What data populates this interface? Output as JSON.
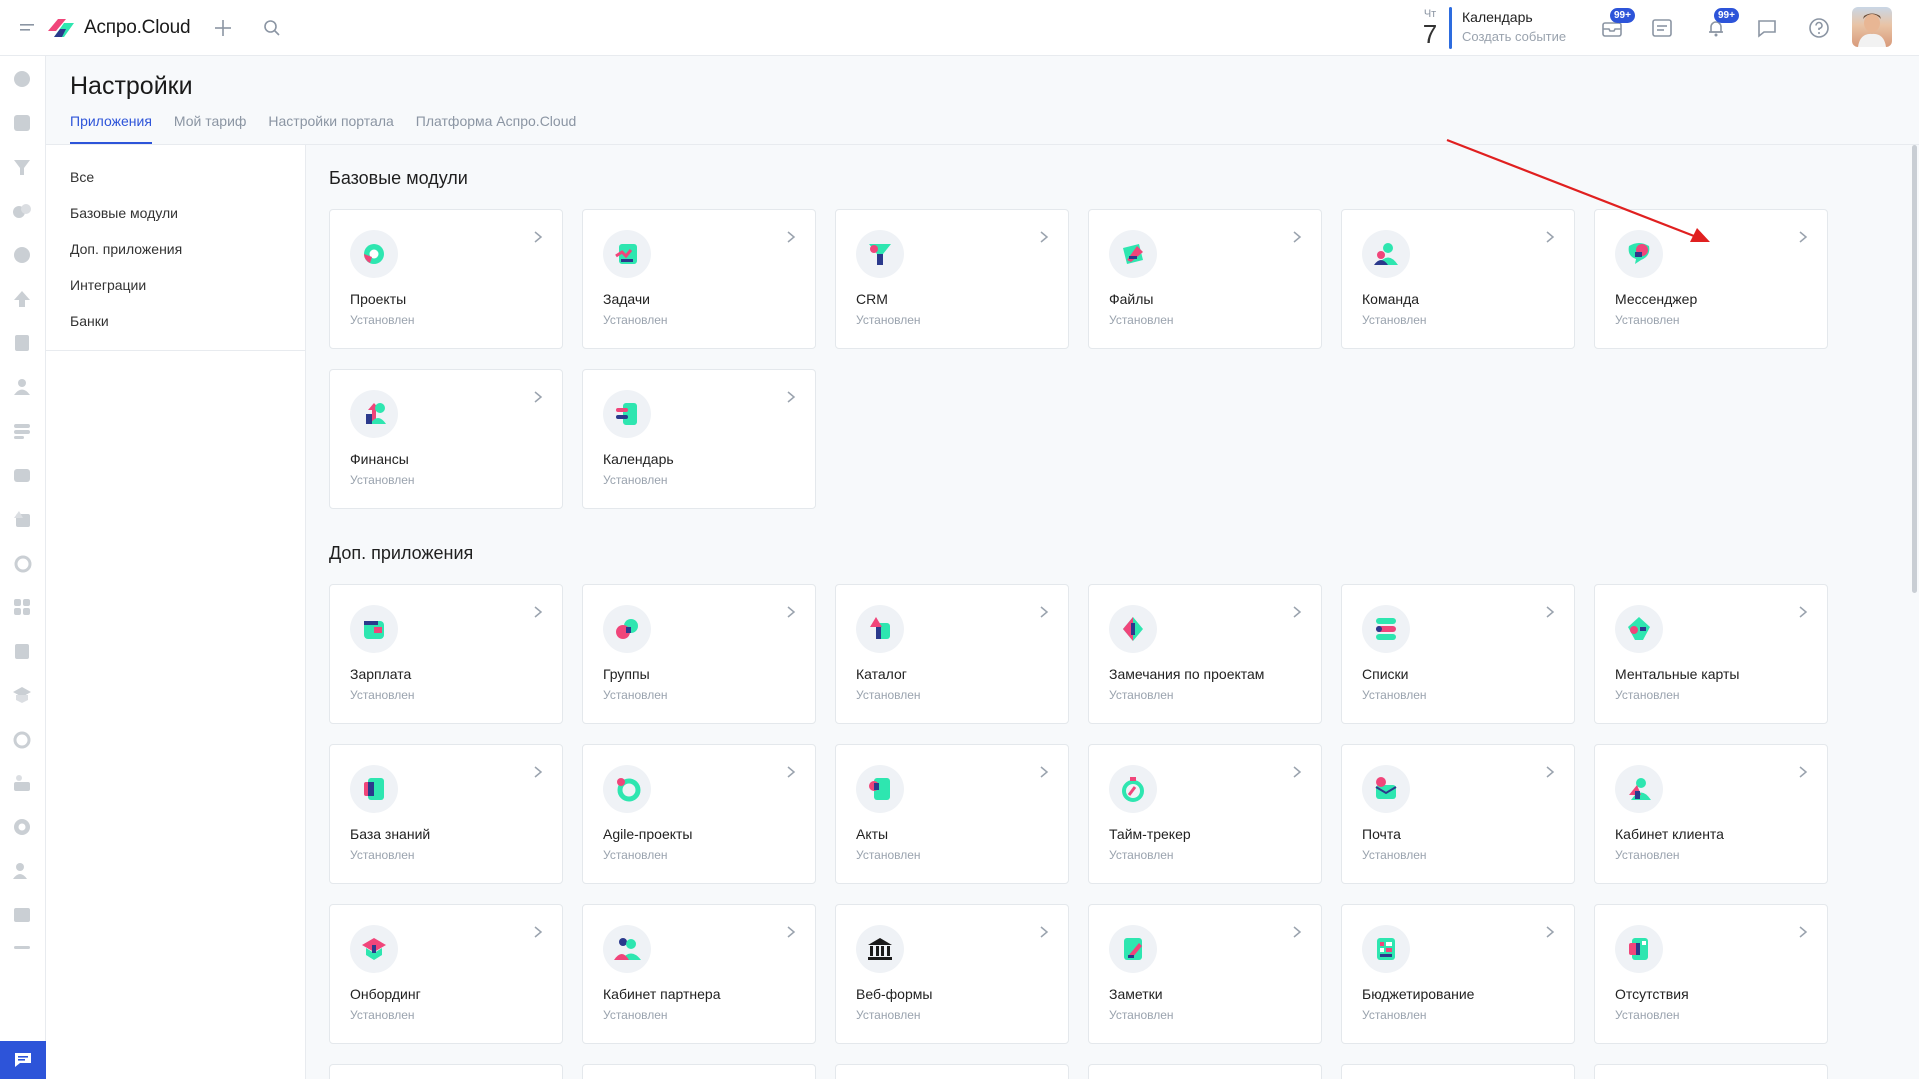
{
  "header": {
    "logo_text": "Аспро.Cloud",
    "calendar": {
      "weekday": "Чт",
      "day": "7",
      "title": "Календарь",
      "subtitle": "Создать событие"
    },
    "badges": {
      "tasks": "99+",
      "notifications": "99+"
    }
  },
  "page": {
    "title": "Настройки",
    "tabs": [
      {
        "label": "Приложения",
        "active": true
      },
      {
        "label": "Мой тариф",
        "active": false
      },
      {
        "label": "Настройки портала",
        "active": false
      },
      {
        "label": "Платформа Аспро.Cloud",
        "active": false
      }
    ]
  },
  "sidenav": [
    "Все",
    "Базовые модули",
    "Доп. приложения",
    "Интеграции",
    "Банки"
  ],
  "sections": [
    {
      "title": "Базовые модули",
      "cards": [
        {
          "name": "Проекты",
          "status": "Установлен",
          "icon": "projects-icon"
        },
        {
          "name": "Задачи",
          "status": "Установлен",
          "icon": "tasks-icon"
        },
        {
          "name": "CRM",
          "status": "Установлен",
          "icon": "crm-icon"
        },
        {
          "name": "Файлы",
          "status": "Установлен",
          "icon": "files-icon"
        },
        {
          "name": "Команда",
          "status": "Установлен",
          "icon": "team-icon"
        },
        {
          "name": "Мессенджер",
          "status": "Установлен",
          "icon": "messenger-icon"
        },
        {
          "name": "Финансы",
          "status": "Установлен",
          "icon": "finance-icon"
        },
        {
          "name": "Календарь",
          "status": "Установлен",
          "icon": "calendar-icon"
        }
      ]
    },
    {
      "title": "Доп. приложения",
      "cards": [
        {
          "name": "Зарплата",
          "status": "Установлен",
          "icon": "salary-icon"
        },
        {
          "name": "Группы",
          "status": "Установлен",
          "icon": "groups-icon"
        },
        {
          "name": "Каталог",
          "status": "Установлен",
          "icon": "catalog-icon"
        },
        {
          "name": "Замечания по проектам",
          "status": "Установлен",
          "icon": "remarks-icon"
        },
        {
          "name": "Списки",
          "status": "Установлен",
          "icon": "lists-icon"
        },
        {
          "name": "Ментальные карты",
          "status": "Установлен",
          "icon": "mindmap-icon"
        },
        {
          "name": "База знаний",
          "status": "Установлен",
          "icon": "knowledge-icon"
        },
        {
          "name": "Agile-проекты",
          "status": "Установлен",
          "icon": "agile-icon"
        },
        {
          "name": "Акты",
          "status": "Установлен",
          "icon": "acts-icon"
        },
        {
          "name": "Тайм-трекер",
          "status": "Установлен",
          "icon": "timer-icon"
        },
        {
          "name": "Почта",
          "status": "Установлен",
          "icon": "mail-icon"
        },
        {
          "name": "Кабинет клиента",
          "status": "Установлен",
          "icon": "client-cabinet-icon"
        },
        {
          "name": "Онбординг",
          "status": "Установлен",
          "icon": "onboarding-icon"
        },
        {
          "name": "Кабинет партнера",
          "status": "Установлен",
          "icon": "partner-cabinet-icon"
        },
        {
          "name": "Веб-формы",
          "status": "Установлен",
          "icon": "webforms-icon"
        },
        {
          "name": "Заметки",
          "status": "Установлен",
          "icon": "notes-icon"
        },
        {
          "name": "Бюджетирование",
          "status": "Установлен",
          "icon": "budget-icon"
        },
        {
          "name": "Отсутствия",
          "status": "Установлен",
          "icon": "absence-icon"
        }
      ]
    }
  ],
  "colors": {
    "accent": "#2d54d9",
    "teal": "#2ee6b0",
    "pink": "#f0457a",
    "navy": "#2b3a8c",
    "annotation_arrow": "#e02020"
  }
}
